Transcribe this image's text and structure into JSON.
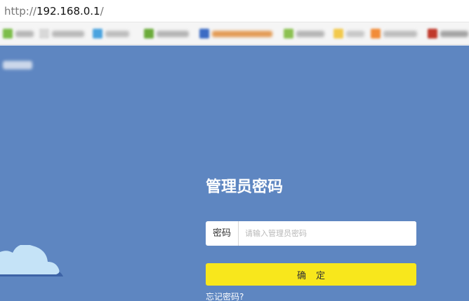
{
  "address_bar": {
    "scheme": "http://",
    "host": "192.168.0.1",
    "path": "/"
  },
  "bookmarks": [
    {
      "icon_color": "#7cbd4a",
      "text_color": "#b6b6b6"
    },
    {
      "icon_color": "#d8d8d8",
      "text_color": "#b9b9b9"
    },
    {
      "icon_color": "#4aa3df",
      "text_color": "#bdbdbd"
    },
    {
      "icon_color": "#6bab3a",
      "text_color": "#b4b4b4"
    },
    {
      "icon_color": "#3b6bc4",
      "text_color": "#e39b55"
    },
    {
      "icon_color": "#8cc152",
      "text_color": "#b5b5b5"
    },
    {
      "icon_color": "#f2c94c",
      "text_color": "#c7c7c7"
    },
    {
      "icon_color": "#f28c38",
      "text_color": "#bdbdbd"
    },
    {
      "icon_color": "#c0392b",
      "text_color": "#a3a3a3"
    }
  ],
  "login": {
    "title": "管理员密码",
    "password_label": "密码",
    "password_placeholder": "请输入管理员密码",
    "password_value": "",
    "confirm_label": "确定",
    "forgot_label": "忘记密码?"
  },
  "colors": {
    "page_background": "#5e86c1",
    "confirm_button": "#f8e71c",
    "cloud_light": "#c5e3f7",
    "cloud_shadow": "#3d63a6"
  }
}
